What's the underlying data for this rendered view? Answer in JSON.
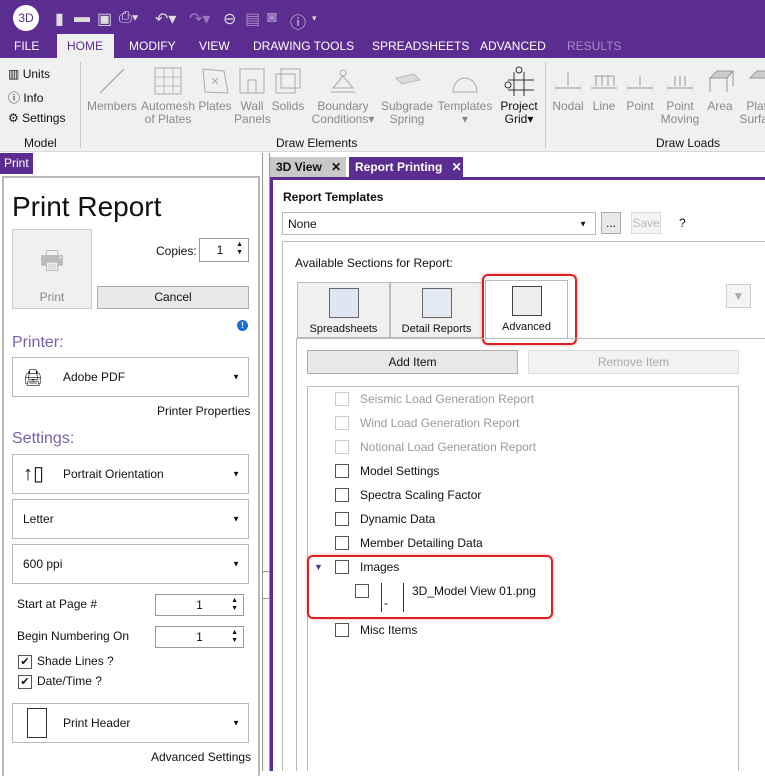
{
  "app": {
    "logo": "3D",
    "accent": "#5c2d91"
  },
  "quick_access": [
    "new-file-icon",
    "open-folder-icon",
    "save-icon",
    "print-icon",
    "undo-icon",
    "redo-icon",
    "minus-circle-icon",
    "report-icon",
    "camera-icon",
    "info-icon",
    "customize-icon"
  ],
  "menu": [
    {
      "label": "FILE"
    },
    {
      "label": "HOME",
      "active": true
    },
    {
      "label": "MODIFY"
    },
    {
      "label": "VIEW"
    },
    {
      "label": "DRAWING TOOLS"
    },
    {
      "label": "SPREADSHEETS"
    },
    {
      "label": "ADVANCED"
    },
    {
      "label": "RESULTS",
      "disabled": true
    }
  ],
  "ribbon": {
    "model": {
      "items": [
        "Units",
        "Info",
        "Settings"
      ],
      "group": "Model"
    },
    "draw_elements": {
      "group": "Draw Elements",
      "items": [
        "Members",
        "Automesh of Plates",
        "Plates",
        "Wall Panels",
        "Solids",
        "Boundary Conditions",
        "Subgrade Spring",
        "Templates",
        "Project Grid"
      ]
    },
    "draw_loads": {
      "group": "Draw Loads",
      "items": [
        "Nodal",
        "Line",
        "Point",
        "Point Moving",
        "Area",
        "Plate Surface"
      ]
    }
  },
  "left": {
    "tab": "Print",
    "title": "Print Report",
    "print_button": "Print",
    "copies_label": "Copies:",
    "copies": "1",
    "cancel": "Cancel",
    "printer_heading": "Printer:",
    "printer": "Adobe PDF",
    "printer_properties": "Printer Properties",
    "settings_heading": "Settings:",
    "orientation": "Portrait Orientation",
    "paper": "Letter",
    "resolution": "600 ppi",
    "start_page_label": "Start at Page #",
    "start_page": "1",
    "begin_numbering_label": "Begin Numbering On",
    "begin_numbering": "1",
    "shade_lines": {
      "label": "Shade Lines ?",
      "checked": true
    },
    "date_time": {
      "label": "Date/Time ?",
      "checked": true
    },
    "header": "Print Header",
    "advanced_settings": "Advanced Settings"
  },
  "tabs": [
    {
      "label": "3D View",
      "active": false
    },
    {
      "label": "Report Printing",
      "active": true
    }
  ],
  "report": {
    "templates_label": "Report Templates",
    "template": "None",
    "more": "...",
    "save": "Save",
    "help": "?",
    "available_label": "Available Sections for Report:",
    "section_tabs": [
      "Spreadsheets",
      "Detail Reports",
      "Advanced"
    ],
    "add_item": "Add Item",
    "remove_item": "Remove Item",
    "items": [
      {
        "label": "Seismic Load Generation Report",
        "disabled": true
      },
      {
        "label": "Wind Load Generation Report",
        "disabled": true
      },
      {
        "label": "Notional Load Generation Report",
        "disabled": true
      },
      {
        "label": "Model Settings"
      },
      {
        "label": "Spectra Scaling Factor"
      },
      {
        "label": "Dynamic Data"
      },
      {
        "label": "Member Detailing Data"
      },
      {
        "label": "Images",
        "expanded": true,
        "children": [
          {
            "label": "3D_Model View 01.png",
            "dash": "-"
          }
        ]
      },
      {
        "label": "Misc Items"
      }
    ]
  }
}
